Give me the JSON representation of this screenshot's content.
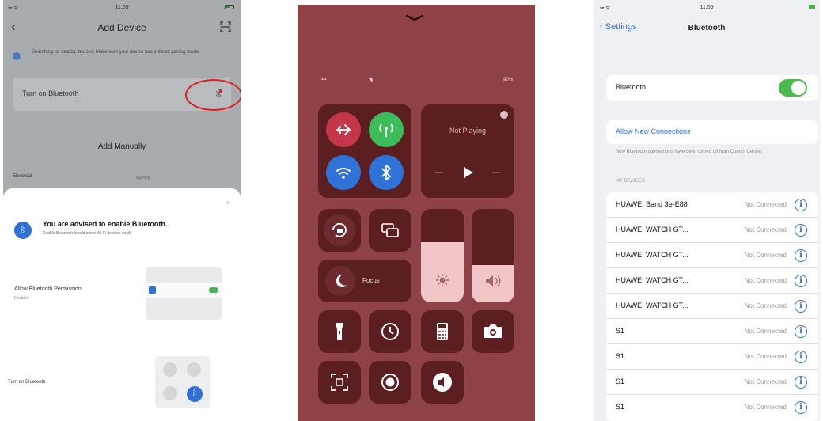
{
  "panel1": {
    "status": {
      "time": "11:55"
    },
    "nav": {
      "title": "Add Device"
    },
    "notice": "Searching for nearby devices. Make sure your device has entered pairing mode.",
    "card": {
      "label": "Turn on Bluetooth"
    },
    "add_manually": "Add Manually",
    "section_label": "Electrical",
    "section_label_right": "Lighting",
    "sheet": {
      "close": "×",
      "title": "You are advised to enable Bluetooth.",
      "subtitle": "Enable Bluetooth to add some Wi-Fi devices easily",
      "permission_label": "Allow Bluetooth Permission",
      "permission_sub": "Enabled",
      "turn_on_label": "Turn on Bluetooth"
    }
  },
  "panel2": {
    "status": {
      "battery": "90%"
    },
    "now_playing": "Not Playing",
    "focus": "Focus"
  },
  "panel3": {
    "status": {
      "time": "11:55"
    },
    "back": "Settings",
    "title": "Bluetooth",
    "bluetooth_label": "Bluetooth",
    "allow_label": "Allow New Connections",
    "allow_note": "New Bluetooth connections have been turned off from Control Centre.",
    "section_header": "MY DEVICES",
    "devices": [
      {
        "name": "HUAWEI Band 3e-E88",
        "status": "Not Connected"
      },
      {
        "name": "HUAWEI WATCH GT...",
        "status": "Not Connected"
      },
      {
        "name": "HUAWEI WATCH GT...",
        "status": "Not Connected"
      },
      {
        "name": "HUAWEI WATCH GT...",
        "status": "Not Connected"
      },
      {
        "name": "HUAWEI WATCH GT...",
        "status": "Not Connected"
      },
      {
        "name": "S1",
        "status": "Not Connected"
      },
      {
        "name": "S1",
        "status": "Not Connected"
      },
      {
        "name": "S1",
        "status": "Not Connected"
      },
      {
        "name": "S1",
        "status": "Not Connected"
      }
    ]
  },
  "colors": {
    "accent_blue": "#2f6fd6",
    "toggle_green": "#4cb94f",
    "control_center_bg": "#8e4146",
    "control_tile": "#5b1f22",
    "highlight_ring": "#e01c1c"
  }
}
